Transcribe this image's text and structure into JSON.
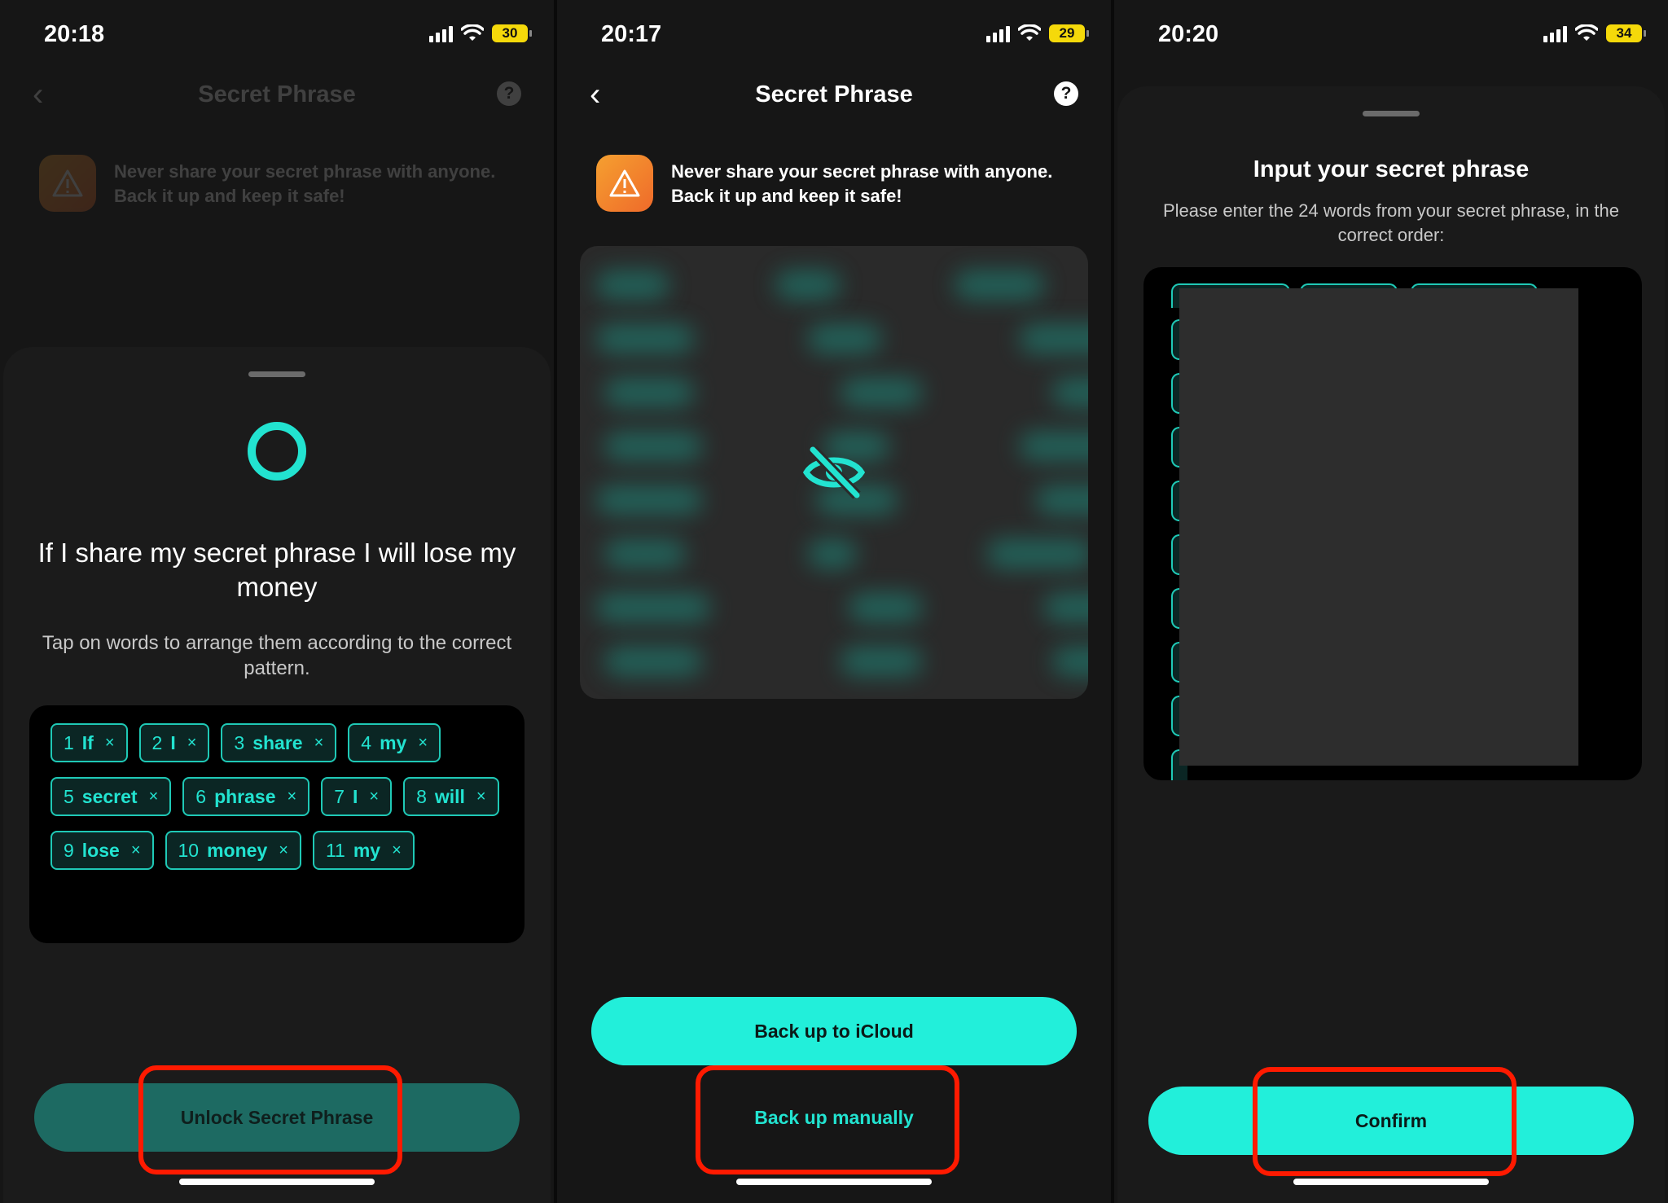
{
  "panel1": {
    "time": "20:18",
    "battery": "30",
    "nav_title": "Secret Phrase",
    "back_icon": "chevron-left-icon",
    "help_icon": "help-bubble-icon",
    "warning_text_line1": "Never share your secret phrase with anyone.",
    "warning_text_line2": "Back it up and keep it safe!",
    "sheet_title": "If I share my secret phrase I will lose my money",
    "sheet_subtitle": "Tap on words to arrange them according to the correct pattern.",
    "chips": [
      {
        "num": "1",
        "word": "If"
      },
      {
        "num": "2",
        "word": "I"
      },
      {
        "num": "3",
        "word": "share"
      },
      {
        "num": "4",
        "word": "my"
      },
      {
        "num": "5",
        "word": "secret"
      },
      {
        "num": "6",
        "word": "phrase"
      },
      {
        "num": "7",
        "word": "I"
      },
      {
        "num": "8",
        "word": "will"
      },
      {
        "num": "9",
        "word": "lose"
      },
      {
        "num": "10",
        "word": "money"
      },
      {
        "num": "11",
        "word": "my"
      }
    ],
    "remove_glyph": "×",
    "unlock_label": "Unlock Secret Phrase"
  },
  "panel2": {
    "time": "20:17",
    "battery": "29",
    "nav_title": "Secret Phrase",
    "back_glyph": "‹",
    "help_glyph": "?",
    "warning_text_line1": "Never share your secret phrase with anyone.",
    "warning_text_line2": "Back it up and keep it safe!",
    "hidden_icon": "eye-slash-icon",
    "icloud_label": "Back up to iCloud",
    "manual_label": "Back up manually"
  },
  "panel3": {
    "time": "20:20",
    "battery": "34",
    "sheet_title": "Input your secret phrase",
    "sheet_subtitle": "Please enter the 24 words from your secret phrase, in the correct order:",
    "confirm_label": "Confirm"
  },
  "colors": {
    "accent": "#22efda",
    "highlight": "#ff1a00",
    "warning": "#f5a030"
  }
}
